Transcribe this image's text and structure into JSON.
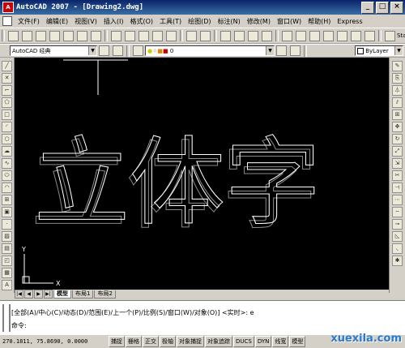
{
  "window": {
    "title": "AutoCAD 2007 - [Drawing2.dwg]",
    "minimize": "_",
    "restore": "□",
    "close": "×"
  },
  "menu": [
    "文件(F)",
    "编辑(E)",
    "视图(V)",
    "插入(I)",
    "格式(O)",
    "工具(T)",
    "绘图(D)",
    "标注(N)",
    "修改(M)",
    "窗口(W)",
    "帮助(H)",
    "Express"
  ],
  "toolbar2": {
    "workspace": "AutoCAD 经典",
    "layer": "0",
    "color": "ByLayer"
  },
  "toolbar1": {
    "right_label": "Stand"
  },
  "drawing": {
    "text": "立体字"
  },
  "ucs": {
    "x_label": "X",
    "y_label": "Y"
  },
  "tabs": [
    "模型",
    "布局1",
    "布局2"
  ],
  "tab_nav": [
    "|◀",
    "◀",
    "▶",
    "▶|"
  ],
  "command": {
    "line1": "[全部(A)/中心(C)/动态(D)/范围(E)/上一个(P)/比例(S)/窗口(W)/对象(O)] <实时>: e",
    "line2": "命令:"
  },
  "status": {
    "coords": "270.1811, 75.8690, 0.0000",
    "buttons": [
      "捕捉",
      "栅格",
      "正交",
      "极轴",
      "对象捕捉",
      "对象追踪",
      "DUCS",
      "DYN",
      "线宽",
      "模型"
    ]
  },
  "watermark": "xuexila.com"
}
